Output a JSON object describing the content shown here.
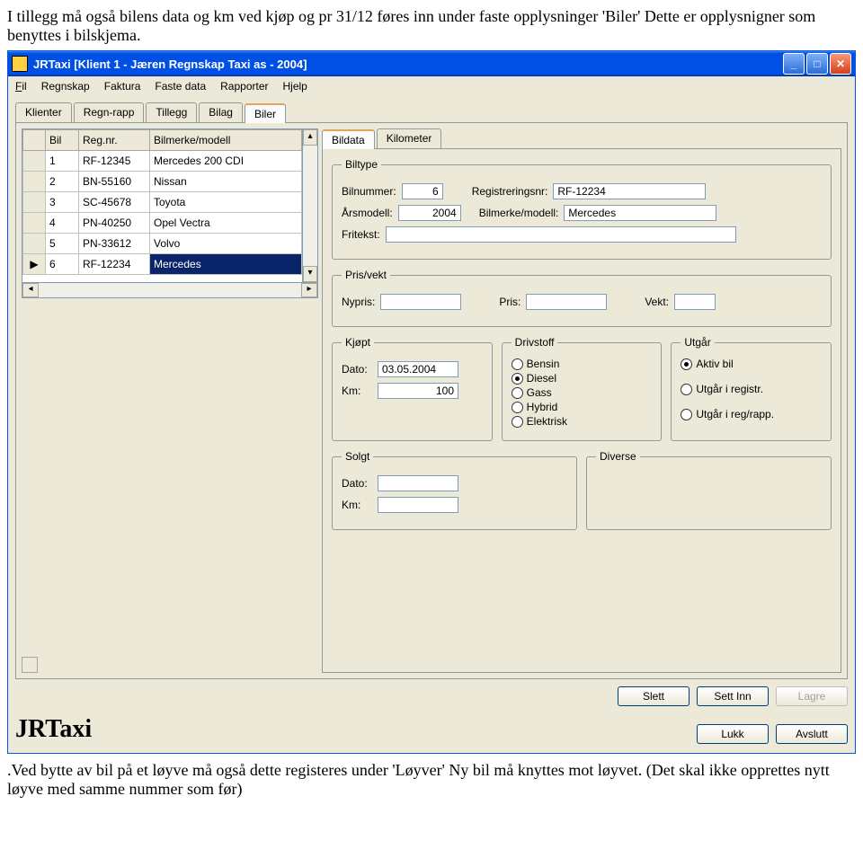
{
  "doc": {
    "text_above": "I tillegg må også bilens data og km ved kjøp og pr 31/12 føres inn under faste opplysninger 'Biler'  Dette er opplysnigner som benyttes i bilskjema.",
    "text_below": ".Ved bytte av bil på et løyve  må også dette registeres under 'Løyver' Ny bil må knyttes mot løyvet.  (Det skal ikke opprettes nytt løyve med samme nummer som før)"
  },
  "window": {
    "title": "JRTaxi [Klient 1 - Jæren Regnskap Taxi as - 2004]",
    "menu": {
      "fil": "Fil",
      "regnskap": "Regnskap",
      "faktura": "Faktura",
      "fastedata": "Faste data",
      "rapporter": "Rapporter",
      "hjelp": "Hjelp"
    },
    "tabs": {
      "klienter": "Klienter",
      "regnrapp": "Regn-rapp",
      "tillegg": "Tillegg",
      "bilag": "Bilag",
      "biler": "Biler"
    },
    "grid": {
      "headers": {
        "bil": "Bil",
        "reg": "Reg.nr.",
        "merke": "Bilmerke/modell"
      },
      "rows": [
        {
          "bil": "1",
          "reg": "RF-12345",
          "merke": "Mercedes 200 CDI"
        },
        {
          "bil": "2",
          "reg": "BN-55160",
          "merke": "Nissan"
        },
        {
          "bil": "3",
          "reg": "SC-45678",
          "merke": "Toyota"
        },
        {
          "bil": "4",
          "reg": "PN-40250",
          "merke": "Opel Vectra"
        },
        {
          "bil": "5",
          "reg": "PN-33612",
          "merke": "Volvo"
        },
        {
          "bil": "6",
          "reg": "RF-12234",
          "merke": "Mercedes"
        }
      ]
    },
    "sub_tabs": {
      "bildata": "Bildata",
      "kilometer": "Kilometer"
    },
    "biltype": {
      "legend": "Biltype",
      "bilnummer_lbl": "Bilnummer:",
      "bilnummer": "6",
      "reg_lbl": "Registreringsnr:",
      "reg": "RF-12234",
      "aarsm_lbl": "Årsmodell:",
      "aarsm": "2004",
      "merke_lbl": "Bilmerke/modell:",
      "merke": "Mercedes",
      "fritekst_lbl": "Fritekst:",
      "fritekst": ""
    },
    "prisvekt": {
      "legend": "Pris/vekt",
      "nypris_lbl": "Nypris:",
      "nypris": "",
      "pris_lbl": "Pris:",
      "pris": "",
      "vekt_lbl": "Vekt:",
      "vekt": ""
    },
    "kjopt": {
      "legend": "Kjøpt",
      "dato_lbl": "Dato:",
      "dato": "03.05.2004",
      "km_lbl": "Km:",
      "km": "100"
    },
    "drivstoff": {
      "legend": "Drivstoff",
      "bensin": "Bensin",
      "diesel": "Diesel",
      "gass": "Gass",
      "hybrid": "Hybrid",
      "elektrisk": "Elektrisk"
    },
    "utgar": {
      "legend": "Utgår",
      "aktiv": "Aktiv bil",
      "utgar_reg": "Utgår i registr.",
      "utgar_rapp": "Utgår i reg/rapp."
    },
    "solgt": {
      "legend": "Solgt",
      "dato_lbl": "Dato:",
      "dato": "",
      "km_lbl": "Km:",
      "km": ""
    },
    "diverse": {
      "legend": "Diverse"
    },
    "buttons": {
      "slett": "Slett",
      "settinn": "Sett Inn",
      "lagre": "Lagre",
      "lukk": "Lukk",
      "avslutt": "Avslutt"
    },
    "logo": "JRTaxi"
  }
}
